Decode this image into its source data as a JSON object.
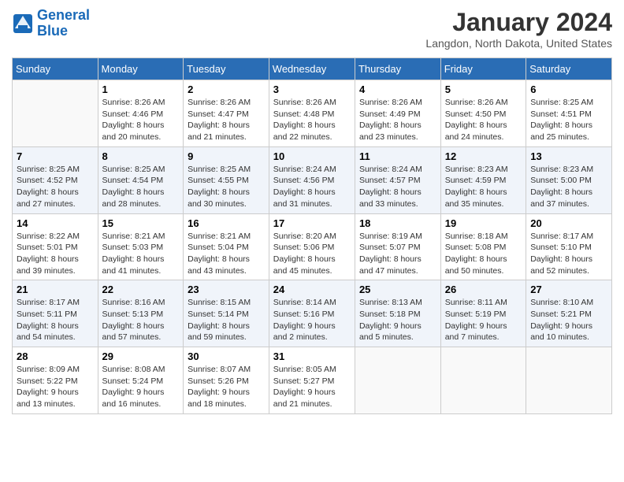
{
  "header": {
    "logo_line1": "General",
    "logo_line2": "Blue",
    "month": "January 2024",
    "location": "Langdon, North Dakota, United States"
  },
  "days_of_week": [
    "Sunday",
    "Monday",
    "Tuesday",
    "Wednesday",
    "Thursday",
    "Friday",
    "Saturday"
  ],
  "weeks": [
    [
      {
        "day": "",
        "info": ""
      },
      {
        "day": "1",
        "info": "Sunrise: 8:26 AM\nSunset: 4:46 PM\nDaylight: 8 hours\nand 20 minutes."
      },
      {
        "day": "2",
        "info": "Sunrise: 8:26 AM\nSunset: 4:47 PM\nDaylight: 8 hours\nand 21 minutes."
      },
      {
        "day": "3",
        "info": "Sunrise: 8:26 AM\nSunset: 4:48 PM\nDaylight: 8 hours\nand 22 minutes."
      },
      {
        "day": "4",
        "info": "Sunrise: 8:26 AM\nSunset: 4:49 PM\nDaylight: 8 hours\nand 23 minutes."
      },
      {
        "day": "5",
        "info": "Sunrise: 8:26 AM\nSunset: 4:50 PM\nDaylight: 8 hours\nand 24 minutes."
      },
      {
        "day": "6",
        "info": "Sunrise: 8:25 AM\nSunset: 4:51 PM\nDaylight: 8 hours\nand 25 minutes."
      }
    ],
    [
      {
        "day": "7",
        "info": "Sunrise: 8:25 AM\nSunset: 4:52 PM\nDaylight: 8 hours\nand 27 minutes."
      },
      {
        "day": "8",
        "info": "Sunrise: 8:25 AM\nSunset: 4:54 PM\nDaylight: 8 hours\nand 28 minutes."
      },
      {
        "day": "9",
        "info": "Sunrise: 8:25 AM\nSunset: 4:55 PM\nDaylight: 8 hours\nand 30 minutes."
      },
      {
        "day": "10",
        "info": "Sunrise: 8:24 AM\nSunset: 4:56 PM\nDaylight: 8 hours\nand 31 minutes."
      },
      {
        "day": "11",
        "info": "Sunrise: 8:24 AM\nSunset: 4:57 PM\nDaylight: 8 hours\nand 33 minutes."
      },
      {
        "day": "12",
        "info": "Sunrise: 8:23 AM\nSunset: 4:59 PM\nDaylight: 8 hours\nand 35 minutes."
      },
      {
        "day": "13",
        "info": "Sunrise: 8:23 AM\nSunset: 5:00 PM\nDaylight: 8 hours\nand 37 minutes."
      }
    ],
    [
      {
        "day": "14",
        "info": "Sunrise: 8:22 AM\nSunset: 5:01 PM\nDaylight: 8 hours\nand 39 minutes."
      },
      {
        "day": "15",
        "info": "Sunrise: 8:21 AM\nSunset: 5:03 PM\nDaylight: 8 hours\nand 41 minutes."
      },
      {
        "day": "16",
        "info": "Sunrise: 8:21 AM\nSunset: 5:04 PM\nDaylight: 8 hours\nand 43 minutes."
      },
      {
        "day": "17",
        "info": "Sunrise: 8:20 AM\nSunset: 5:06 PM\nDaylight: 8 hours\nand 45 minutes."
      },
      {
        "day": "18",
        "info": "Sunrise: 8:19 AM\nSunset: 5:07 PM\nDaylight: 8 hours\nand 47 minutes."
      },
      {
        "day": "19",
        "info": "Sunrise: 8:18 AM\nSunset: 5:08 PM\nDaylight: 8 hours\nand 50 minutes."
      },
      {
        "day": "20",
        "info": "Sunrise: 8:17 AM\nSunset: 5:10 PM\nDaylight: 8 hours\nand 52 minutes."
      }
    ],
    [
      {
        "day": "21",
        "info": "Sunrise: 8:17 AM\nSunset: 5:11 PM\nDaylight: 8 hours\nand 54 minutes."
      },
      {
        "day": "22",
        "info": "Sunrise: 8:16 AM\nSunset: 5:13 PM\nDaylight: 8 hours\nand 57 minutes."
      },
      {
        "day": "23",
        "info": "Sunrise: 8:15 AM\nSunset: 5:14 PM\nDaylight: 8 hours\nand 59 minutes."
      },
      {
        "day": "24",
        "info": "Sunrise: 8:14 AM\nSunset: 5:16 PM\nDaylight: 9 hours\nand 2 minutes."
      },
      {
        "day": "25",
        "info": "Sunrise: 8:13 AM\nSunset: 5:18 PM\nDaylight: 9 hours\nand 5 minutes."
      },
      {
        "day": "26",
        "info": "Sunrise: 8:11 AM\nSunset: 5:19 PM\nDaylight: 9 hours\nand 7 minutes."
      },
      {
        "day": "27",
        "info": "Sunrise: 8:10 AM\nSunset: 5:21 PM\nDaylight: 9 hours\nand 10 minutes."
      }
    ],
    [
      {
        "day": "28",
        "info": "Sunrise: 8:09 AM\nSunset: 5:22 PM\nDaylight: 9 hours\nand 13 minutes."
      },
      {
        "day": "29",
        "info": "Sunrise: 8:08 AM\nSunset: 5:24 PM\nDaylight: 9 hours\nand 16 minutes."
      },
      {
        "day": "30",
        "info": "Sunrise: 8:07 AM\nSunset: 5:26 PM\nDaylight: 9 hours\nand 18 minutes."
      },
      {
        "day": "31",
        "info": "Sunrise: 8:05 AM\nSunset: 5:27 PM\nDaylight: 9 hours\nand 21 minutes."
      },
      {
        "day": "",
        "info": ""
      },
      {
        "day": "",
        "info": ""
      },
      {
        "day": "",
        "info": ""
      }
    ]
  ]
}
